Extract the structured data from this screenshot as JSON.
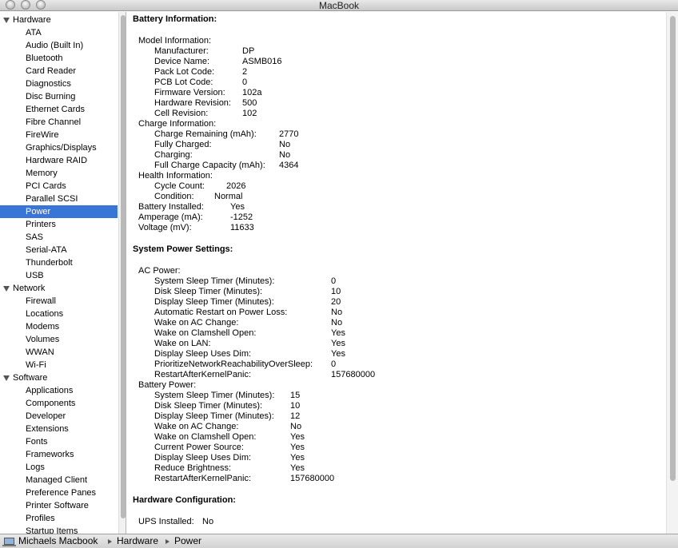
{
  "window": {
    "title": "MacBook"
  },
  "sidebar": {
    "groups": [
      {
        "label": "Hardware",
        "items": [
          "ATA",
          "Audio (Built In)",
          "Bluetooth",
          "Card Reader",
          "Diagnostics",
          "Disc Burning",
          "Ethernet Cards",
          "Fibre Channel",
          "FireWire",
          "Graphics/Displays",
          "Hardware RAID",
          "Memory",
          "PCI Cards",
          "Parallel SCSI",
          "Power",
          "Printers",
          "SAS",
          "Serial-ATA",
          "Thunderbolt",
          "USB"
        ]
      },
      {
        "label": "Network",
        "items": [
          "Firewall",
          "Locations",
          "Modems",
          "Volumes",
          "WWAN",
          "Wi-Fi"
        ]
      },
      {
        "label": "Software",
        "items": [
          "Applications",
          "Components",
          "Developer",
          "Extensions",
          "Fonts",
          "Frameworks",
          "Logs",
          "Managed Client",
          "Preference Panes",
          "Printer Software",
          "Profiles",
          "Startup Items"
        ]
      }
    ],
    "selected": "Power"
  },
  "content": {
    "battery_heading": "Battery Information:",
    "model_info_label": "Model Information:",
    "manufacturer_label": "Manufacturer:",
    "manufacturer": "DP",
    "device_name_label": "Device Name:",
    "device_name": "ASMB016",
    "pack_lot_label": "Pack Lot Code:",
    "pack_lot": "2",
    "pcb_lot_label": "PCB Lot Code:",
    "pcb_lot": "0",
    "firmware_label": "Firmware Version:",
    "firmware": "102a",
    "hardware_rev_label": "Hardware Revision:",
    "hardware_rev": "500",
    "cell_rev_label": "Cell Revision:",
    "cell_rev": "102",
    "charge_info_label": "Charge Information:",
    "charge_remaining_label": "Charge Remaining (mAh):",
    "charge_remaining": "2770",
    "fully_charged_label": "Fully Charged:",
    "fully_charged": "No",
    "charging_label": "Charging:",
    "charging": "No",
    "full_capacity_label": "Full Charge Capacity (mAh):",
    "full_capacity": "4364",
    "health_info_label": "Health Information:",
    "cycle_count_label": "Cycle Count:",
    "cycle_count": "2026",
    "condition_label": "Condition:",
    "condition": "Normal",
    "battery_installed_label": "Battery Installed:",
    "battery_installed": "Yes",
    "amperage_label": "Amperage (mA):",
    "amperage": "-1252",
    "voltage_label": "Voltage (mV):",
    "voltage": "11633",
    "power_settings_heading": "System Power Settings:",
    "ac_power_label": "AC Power:",
    "ac": [
      {
        "label": "System Sleep Timer (Minutes):",
        "value": "0"
      },
      {
        "label": "Disk Sleep Timer (Minutes):",
        "value": "10"
      },
      {
        "label": "Display Sleep Timer (Minutes):",
        "value": "20"
      },
      {
        "label": "Automatic Restart on Power Loss:",
        "value": "No"
      },
      {
        "label": "Wake on AC Change:",
        "value": "No"
      },
      {
        "label": "Wake on Clamshell Open:",
        "value": "Yes"
      },
      {
        "label": "Wake on LAN:",
        "value": "Yes"
      },
      {
        "label": "Display Sleep Uses Dim:",
        "value": "Yes"
      },
      {
        "label": "PrioritizeNetworkReachabilityOverSleep:",
        "value": "0"
      },
      {
        "label": "RestartAfterKernelPanic:",
        "value": "157680000"
      }
    ],
    "battery_power_label": "Battery Power:",
    "batt": [
      {
        "label": "System Sleep Timer (Minutes):",
        "value": "15"
      },
      {
        "label": "Disk Sleep Timer (Minutes):",
        "value": "10"
      },
      {
        "label": "Display Sleep Timer (Minutes):",
        "value": "12"
      },
      {
        "label": "Wake on AC Change:",
        "value": "No"
      },
      {
        "label": "Wake on Clamshell Open:",
        "value": "Yes"
      },
      {
        "label": "Current Power Source:",
        "value": "Yes"
      },
      {
        "label": "Display Sleep Uses Dim:",
        "value": "Yes"
      },
      {
        "label": "Reduce Brightness:",
        "value": "Yes"
      },
      {
        "label": "RestartAfterKernelPanic:",
        "value": "157680000"
      }
    ],
    "hw_config_heading": "Hardware Configuration:",
    "ups_label": "UPS Installed:",
    "ups": "No"
  },
  "pathbar": {
    "computer": "Michaels Macbook",
    "section": "Hardware",
    "item": "Power"
  },
  "colors": {
    "selection": "#3875d7"
  }
}
